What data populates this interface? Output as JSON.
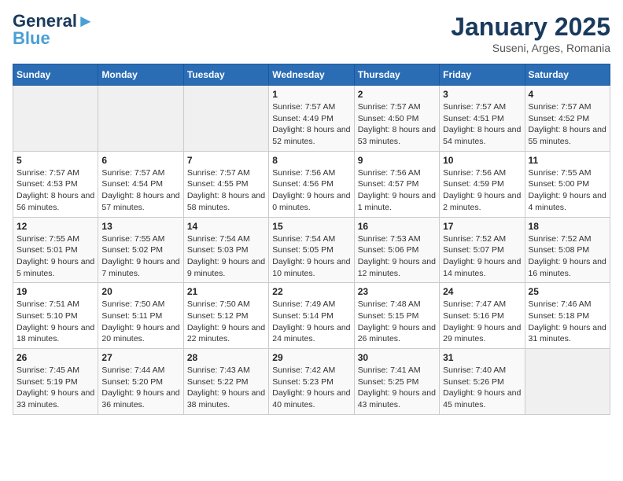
{
  "logo": {
    "line1": "General",
    "line2": "Blue"
  },
  "title": "January 2025",
  "subtitle": "Suseni, Arges, Romania",
  "days_of_week": [
    "Sunday",
    "Monday",
    "Tuesday",
    "Wednesday",
    "Thursday",
    "Friday",
    "Saturday"
  ],
  "weeks": [
    [
      {
        "day": "",
        "info": ""
      },
      {
        "day": "",
        "info": ""
      },
      {
        "day": "",
        "info": ""
      },
      {
        "day": "1",
        "info": "Sunrise: 7:57 AM\nSunset: 4:49 PM\nDaylight: 8 hours and 52 minutes."
      },
      {
        "day": "2",
        "info": "Sunrise: 7:57 AM\nSunset: 4:50 PM\nDaylight: 8 hours and 53 minutes."
      },
      {
        "day": "3",
        "info": "Sunrise: 7:57 AM\nSunset: 4:51 PM\nDaylight: 8 hours and 54 minutes."
      },
      {
        "day": "4",
        "info": "Sunrise: 7:57 AM\nSunset: 4:52 PM\nDaylight: 8 hours and 55 minutes."
      }
    ],
    [
      {
        "day": "5",
        "info": "Sunrise: 7:57 AM\nSunset: 4:53 PM\nDaylight: 8 hours and 56 minutes."
      },
      {
        "day": "6",
        "info": "Sunrise: 7:57 AM\nSunset: 4:54 PM\nDaylight: 8 hours and 57 minutes."
      },
      {
        "day": "7",
        "info": "Sunrise: 7:57 AM\nSunset: 4:55 PM\nDaylight: 8 hours and 58 minutes."
      },
      {
        "day": "8",
        "info": "Sunrise: 7:56 AM\nSunset: 4:56 PM\nDaylight: 9 hours and 0 minutes."
      },
      {
        "day": "9",
        "info": "Sunrise: 7:56 AM\nSunset: 4:57 PM\nDaylight: 9 hours and 1 minute."
      },
      {
        "day": "10",
        "info": "Sunrise: 7:56 AM\nSunset: 4:59 PM\nDaylight: 9 hours and 2 minutes."
      },
      {
        "day": "11",
        "info": "Sunrise: 7:55 AM\nSunset: 5:00 PM\nDaylight: 9 hours and 4 minutes."
      }
    ],
    [
      {
        "day": "12",
        "info": "Sunrise: 7:55 AM\nSunset: 5:01 PM\nDaylight: 9 hours and 5 minutes."
      },
      {
        "day": "13",
        "info": "Sunrise: 7:55 AM\nSunset: 5:02 PM\nDaylight: 9 hours and 7 minutes."
      },
      {
        "day": "14",
        "info": "Sunrise: 7:54 AM\nSunset: 5:03 PM\nDaylight: 9 hours and 9 minutes."
      },
      {
        "day": "15",
        "info": "Sunrise: 7:54 AM\nSunset: 5:05 PM\nDaylight: 9 hours and 10 minutes."
      },
      {
        "day": "16",
        "info": "Sunrise: 7:53 AM\nSunset: 5:06 PM\nDaylight: 9 hours and 12 minutes."
      },
      {
        "day": "17",
        "info": "Sunrise: 7:52 AM\nSunset: 5:07 PM\nDaylight: 9 hours and 14 minutes."
      },
      {
        "day": "18",
        "info": "Sunrise: 7:52 AM\nSunset: 5:08 PM\nDaylight: 9 hours and 16 minutes."
      }
    ],
    [
      {
        "day": "19",
        "info": "Sunrise: 7:51 AM\nSunset: 5:10 PM\nDaylight: 9 hours and 18 minutes."
      },
      {
        "day": "20",
        "info": "Sunrise: 7:50 AM\nSunset: 5:11 PM\nDaylight: 9 hours and 20 minutes."
      },
      {
        "day": "21",
        "info": "Sunrise: 7:50 AM\nSunset: 5:12 PM\nDaylight: 9 hours and 22 minutes."
      },
      {
        "day": "22",
        "info": "Sunrise: 7:49 AM\nSunset: 5:14 PM\nDaylight: 9 hours and 24 minutes."
      },
      {
        "day": "23",
        "info": "Sunrise: 7:48 AM\nSunset: 5:15 PM\nDaylight: 9 hours and 26 minutes."
      },
      {
        "day": "24",
        "info": "Sunrise: 7:47 AM\nSunset: 5:16 PM\nDaylight: 9 hours and 29 minutes."
      },
      {
        "day": "25",
        "info": "Sunrise: 7:46 AM\nSunset: 5:18 PM\nDaylight: 9 hours and 31 minutes."
      }
    ],
    [
      {
        "day": "26",
        "info": "Sunrise: 7:45 AM\nSunset: 5:19 PM\nDaylight: 9 hours and 33 minutes."
      },
      {
        "day": "27",
        "info": "Sunrise: 7:44 AM\nSunset: 5:20 PM\nDaylight: 9 hours and 36 minutes."
      },
      {
        "day": "28",
        "info": "Sunrise: 7:43 AM\nSunset: 5:22 PM\nDaylight: 9 hours and 38 minutes."
      },
      {
        "day": "29",
        "info": "Sunrise: 7:42 AM\nSunset: 5:23 PM\nDaylight: 9 hours and 40 minutes."
      },
      {
        "day": "30",
        "info": "Sunrise: 7:41 AM\nSunset: 5:25 PM\nDaylight: 9 hours and 43 minutes."
      },
      {
        "day": "31",
        "info": "Sunrise: 7:40 AM\nSunset: 5:26 PM\nDaylight: 9 hours and 45 minutes."
      },
      {
        "day": "",
        "info": ""
      }
    ]
  ]
}
